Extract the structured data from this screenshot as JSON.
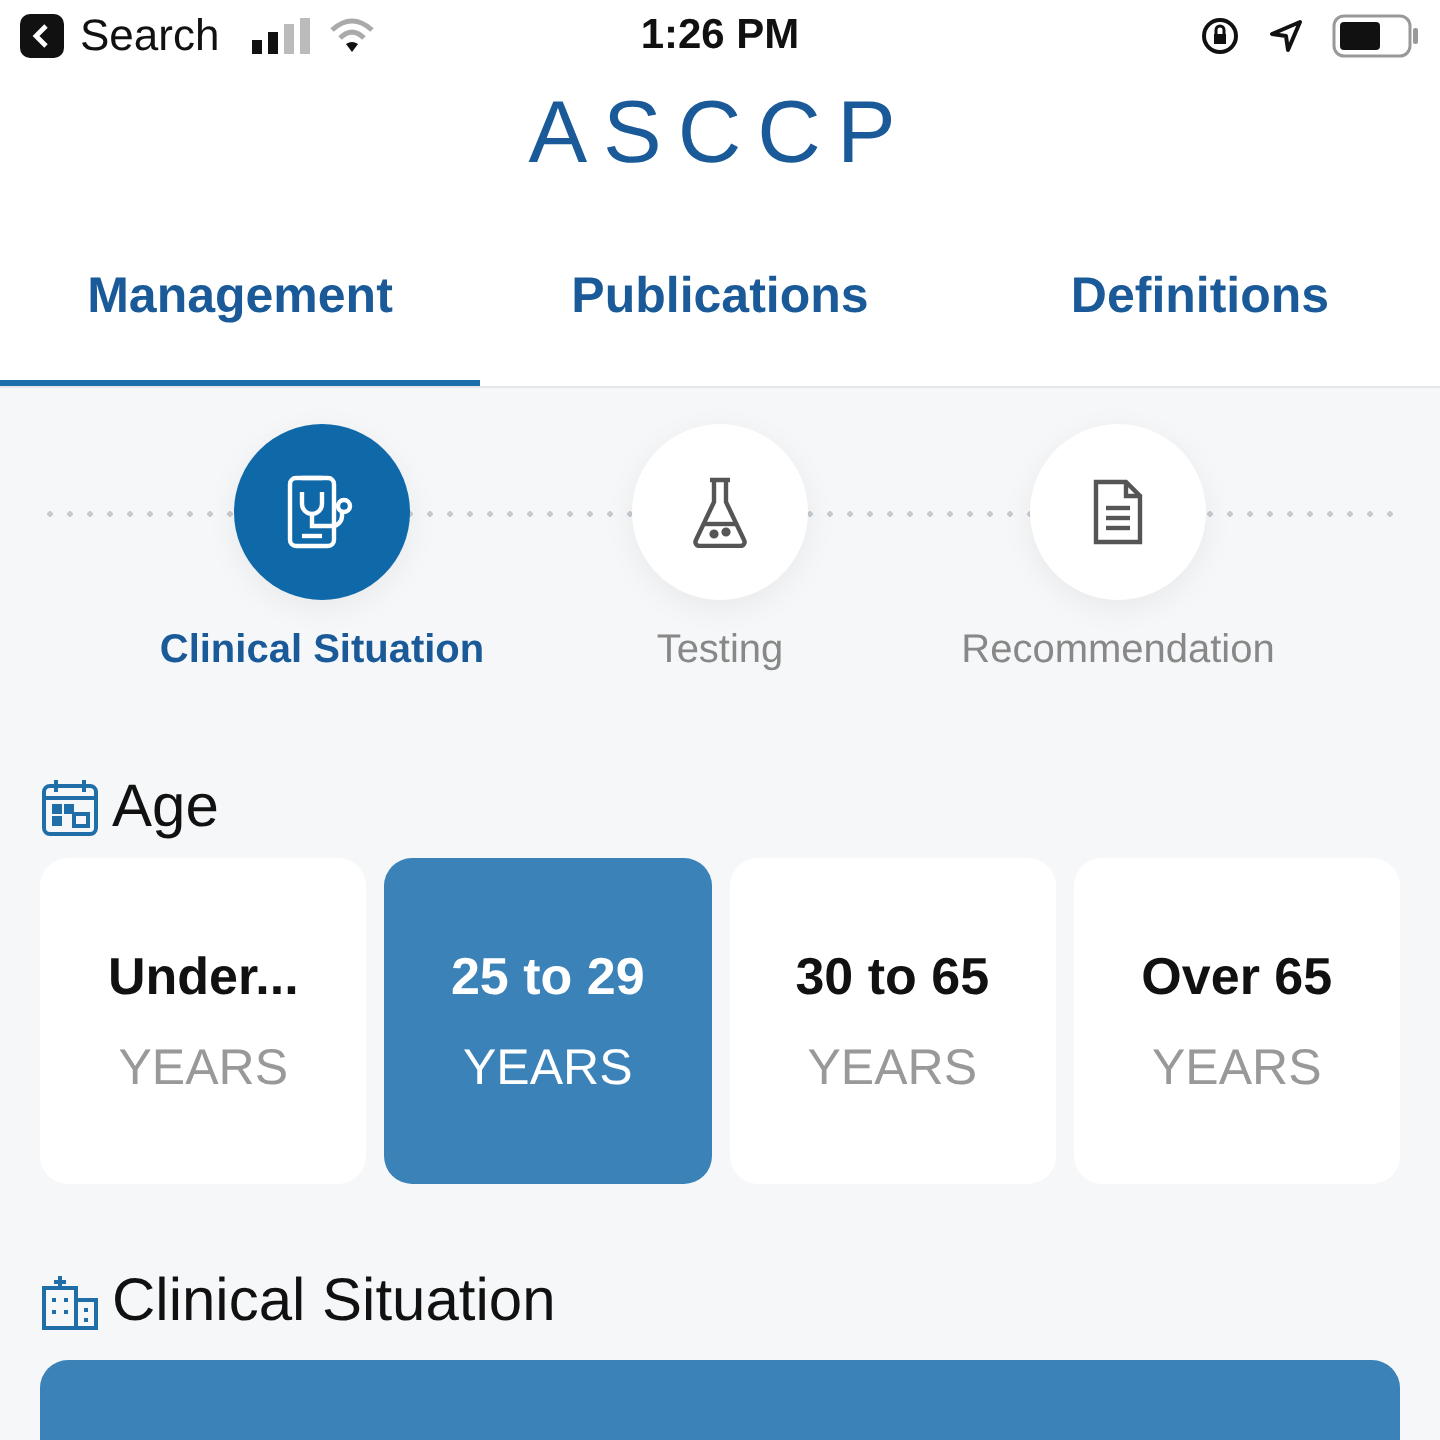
{
  "status_bar": {
    "back_label": "Search",
    "time": "1:26 PM"
  },
  "logo": "ASCCP",
  "tabs": [
    {
      "label": "Management",
      "selected": true
    },
    {
      "label": "Publications",
      "selected": false
    },
    {
      "label": "Definitions",
      "selected": false
    }
  ],
  "steps": [
    {
      "label": "Clinical Situation",
      "kind": "clipboard",
      "selected": true
    },
    {
      "label": "Testing",
      "kind": "flask",
      "selected": false
    },
    {
      "label": "Recommendation",
      "kind": "document",
      "selected": false
    }
  ],
  "age": {
    "title": "Age",
    "options": [
      {
        "value": "Under...",
        "unit": "YEARS",
        "selected": false
      },
      {
        "value": "25 to 29",
        "unit": "YEARS",
        "selected": true
      },
      {
        "value": "30 to 65",
        "unit": "YEARS",
        "selected": false
      },
      {
        "value": "Over 65",
        "unit": "YEARS",
        "selected": false
      }
    ]
  },
  "clinical_situation": {
    "title": "Clinical Situation"
  }
}
